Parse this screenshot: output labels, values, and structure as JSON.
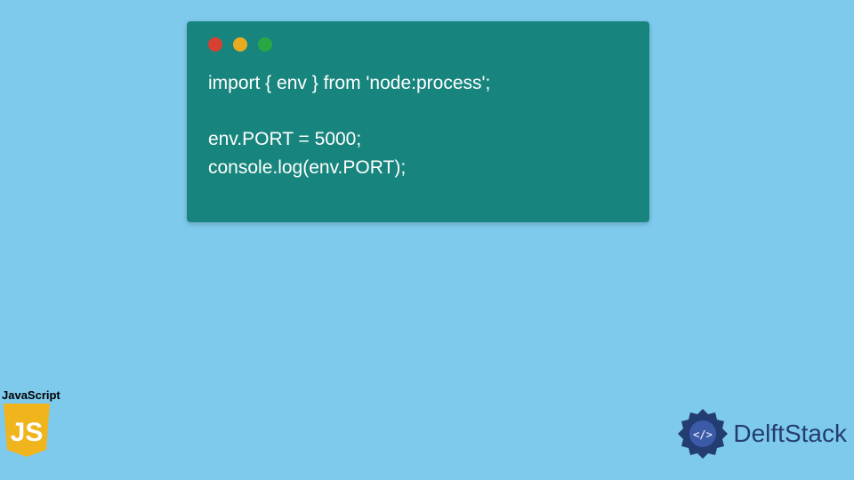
{
  "code": {
    "line1": "import { env } from 'node:process';",
    "line2": "",
    "line3": "env.PORT = 5000;",
    "line4": "console.log(env.PORT);"
  },
  "jsBadge": {
    "label": "JavaScript",
    "shieldText": "JS"
  },
  "brand": {
    "name": "DelftStack"
  },
  "colors": {
    "background": "#7ecaed",
    "codeWindow": "#17857d",
    "dotRed": "#d84131",
    "dotYellow": "#e8ab1f",
    "dotGreen": "#28a842",
    "jsYellow": "#f0b41c",
    "brandBlue": "#233c72"
  }
}
